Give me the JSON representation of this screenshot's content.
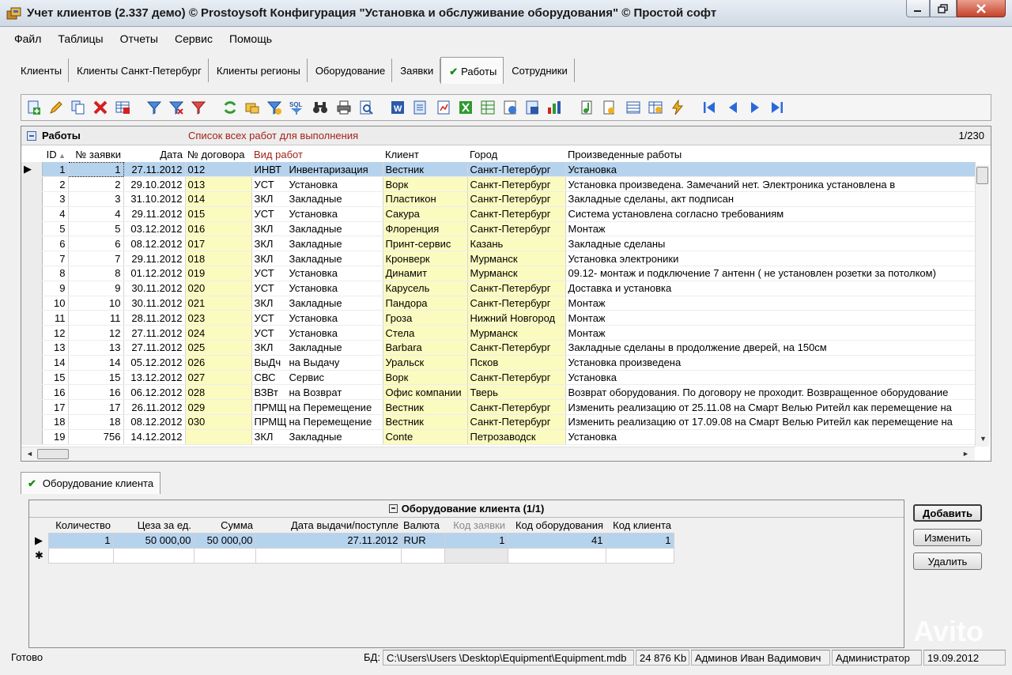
{
  "window": {
    "title": "Учет клиентов (2.337 демо) © Prostoysoft  Конфигурация \"Установка и обслуживание оборудования\" © Простой софт"
  },
  "menu": [
    {
      "label": "Файл"
    },
    {
      "label": "Таблицы"
    },
    {
      "label": "Отчеты"
    },
    {
      "label": "Сервис"
    },
    {
      "label": "Помощь"
    }
  ],
  "tabs": [
    {
      "label": "Клиенты"
    },
    {
      "label": "Клиенты Санкт-Петербург"
    },
    {
      "label": "Клиенты регионы"
    },
    {
      "label": "Оборудование"
    },
    {
      "label": "Заявки"
    },
    {
      "label": "Работы",
      "active": true
    },
    {
      "label": "Сотрудники"
    }
  ],
  "grid": {
    "title": "Работы",
    "subtitle": "Список всех работ для выполнения",
    "counter": "1/230",
    "columns": [
      "ID",
      "№ заявки",
      "Дата",
      "№ договора",
      "Вид работ",
      "Клиент",
      "Город",
      "Произведенные работы"
    ],
    "rows": [
      {
        "id": "1",
        "req": "1",
        "date": "27.11.2012",
        "contract": "012",
        "type": "ИНВТ",
        "typeName": "Инвентаризация",
        "client": "Вестник",
        "city": "Санкт-Петербург",
        "work": "Установка"
      },
      {
        "id": "2",
        "req": "2",
        "date": "29.10.2012",
        "contract": "013",
        "type": "УСТ",
        "typeName": "Установка",
        "client": "Ворк",
        "city": "Санкт-Петербург",
        "work": "Установка произведена. Замечаний нет. Электроника установлена в"
      },
      {
        "id": "3",
        "req": "3",
        "date": "31.10.2012",
        "contract": "014",
        "type": "ЗКЛ",
        "typeName": "Закладные",
        "client": "Пластикон",
        "city": "Санкт-Петербург",
        "work": "Закладные сделаны, акт подписан"
      },
      {
        "id": "4",
        "req": "4",
        "date": "29.11.2012",
        "contract": "015",
        "type": "УСТ",
        "typeName": "Установка",
        "client": "Сакура",
        "city": "Санкт-Петербург",
        "work": "Система установлена согласно требованиям"
      },
      {
        "id": "5",
        "req": "5",
        "date": "03.12.2012",
        "contract": "016",
        "type": "ЗКЛ",
        "typeName": "Закладные",
        "client": "Флоренция",
        "city": "Санкт-Петербург",
        "work": "Монтаж"
      },
      {
        "id": "6",
        "req": "6",
        "date": "08.12.2012",
        "contract": "017",
        "type": "ЗКЛ",
        "typeName": "Закладные",
        "client": "Принт-сервис",
        "city": "Казань",
        "work": "Закладные сделаны"
      },
      {
        "id": "7",
        "req": "7",
        "date": "29.11.2012",
        "contract": "018",
        "type": "ЗКЛ",
        "typeName": "Закладные",
        "client": "Кронверк",
        "city": "Мурманск",
        "work": "Установка электроники"
      },
      {
        "id": "8",
        "req": "8",
        "date": "01.12.2012",
        "contract": "019",
        "type": "УСТ",
        "typeName": "Установка",
        "client": "Динамит",
        "city": "Мурманск",
        "work": "09.12- монтаж и подключение 7 антенн ( не установлен розетки за потолком)"
      },
      {
        "id": "9",
        "req": "9",
        "date": "30.11.2012",
        "contract": "020",
        "type": "УСТ",
        "typeName": "Установка",
        "client": "Карусель",
        "city": "Санкт-Петербург",
        "work": "Доставка и установка"
      },
      {
        "id": "10",
        "req": "10",
        "date": "30.11.2012",
        "contract": "021",
        "type": "ЗКЛ",
        "typeName": "Закладные",
        "client": "Пандора",
        "city": "Санкт-Петербург",
        "work": "Монтаж"
      },
      {
        "id": "11",
        "req": "11",
        "date": "28.11.2012",
        "contract": "023",
        "type": "УСТ",
        "typeName": "Установка",
        "client": "Гроза",
        "city": "Нижний Новгород",
        "work": "Монтаж"
      },
      {
        "id": "12",
        "req": "12",
        "date": "27.11.2012",
        "contract": "024",
        "type": "УСТ",
        "typeName": "Установка",
        "client": "Стела",
        "city": "Мурманск",
        "work": "Монтаж"
      },
      {
        "id": "13",
        "req": "13",
        "date": "27.11.2012",
        "contract": "025",
        "type": "ЗКЛ",
        "typeName": "Закладные",
        "client": "Barbara",
        "city": "Санкт-Петербург",
        "work": "Закладные сделаны в продолжение дверей, на 150см"
      },
      {
        "id": "14",
        "req": "14",
        "date": "05.12.2012",
        "contract": "026",
        "type": "ВыДч",
        "typeName": "на Выдачу",
        "client": "Уральск",
        "city": "Псков",
        "work": "Установка произведена"
      },
      {
        "id": "15",
        "req": "15",
        "date": "13.12.2012",
        "contract": "027",
        "type": "СВС",
        "typeName": "Сервис",
        "client": "Ворк",
        "city": "Санкт-Петербург",
        "work": "Установка"
      },
      {
        "id": "16",
        "req": "16",
        "date": "06.12.2012",
        "contract": "028",
        "type": "ВЗВт",
        "typeName": "на Возврат",
        "client": "Офис компании",
        "city": "Тверь",
        "work": "Возврат оборудования. По договору не проходит. Возвращенное оборудование"
      },
      {
        "id": "17",
        "req": "17",
        "date": "26.11.2012",
        "contract": "029",
        "type": "ПРМЩ",
        "typeName": "на Перемещение",
        "client": "Вестник",
        "city": "Санкт-Петербург",
        "work": "Изменить реализацию от 25.11.08 на Смарт Велью Ритейл как перемещение на"
      },
      {
        "id": "18",
        "req": "18",
        "date": "08.12.2012",
        "contract": "030",
        "type": "ПРМЩ",
        "typeName": "на Перемещение",
        "client": "Вестник",
        "city": "Санкт-Петербург",
        "work": "Изменить реализацию от 17.09.08 на Смарт Велью Ритейл как перемещение на"
      },
      {
        "id": "19",
        "req": "756",
        "date": "14.12.2012",
        "contract": "",
        "type": "ЗКЛ",
        "typeName": "Закладные",
        "client": "Conte",
        "city": "Петрозаводск",
        "work": "Установка"
      }
    ]
  },
  "lower_tab": {
    "label": "Оборудование клиента"
  },
  "equipment": {
    "title": "Оборудование клиента (1/1)",
    "columns": [
      "Количество",
      "Цеза за ед.",
      "Сумма",
      "Дата выдачи/поступле",
      "Валюта",
      "Код заявки",
      "Код оборудования",
      "Код клиента"
    ],
    "rows": [
      {
        "qty": "1",
        "price": "50 000,00",
        "sum": "50 000,00",
        "date": "27.11.2012",
        "currency": "RUR",
        "req_code": "1",
        "equip_code": "41",
        "client_code": "1"
      }
    ]
  },
  "buttons": {
    "add": "Добавить",
    "edit": "Изменить",
    "delete": "Удалить"
  },
  "status": {
    "ready": "Готово",
    "db_label": "БД:",
    "db_path": "C:\\Users\\Users \\Desktop\\Equipment\\Equipment.mdb",
    "size": "24 876 Kb",
    "user": "Админов Иван Вадимович",
    "role": "Администратор",
    "date": "19.09.2012"
  },
  "watermark": "Avito",
  "colors": {
    "selection": "#b6d3ee",
    "highlight_column": "#fbfbc0",
    "accent_red": "#a3231a",
    "check_green": "#1a8a1a"
  }
}
